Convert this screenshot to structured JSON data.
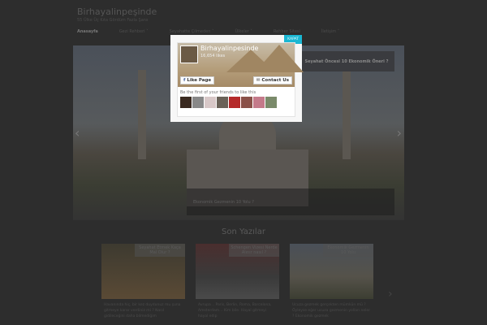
{
  "header": {
    "title": "Birhayalinpeşinde",
    "tagline": "55 Ülke Üç Kıta Gördüm Fazla Şans"
  },
  "nav": [
    {
      "label": "Anasayfa"
    },
    {
      "label": "Gezi Rehberi ˅"
    },
    {
      "label": "Seyahatte Çilmeden ˅"
    },
    {
      "label": "Ülkeler ˅"
    },
    {
      "label": "Rehber Sitesi"
    },
    {
      "label": "İletişim ˅"
    }
  ],
  "slider": {
    "side_title": "Seyahat Öncesi 10 Ekonomik Öneri ?",
    "caption": "Ekonomik Gezmenin 10 Yolu ?",
    "prev": "‹",
    "next": "›"
  },
  "section": {
    "title": "Son Yazılar",
    "next": "›"
  },
  "posts": [
    {
      "title": "Seyahat Etmek Kaça Mal Olur ?",
      "excerpt": "Havanında hiç, bir kez duydunuz mu şuna gitmeye karar verdiniz mi ? Nasıl gidileceğini daha bilmediğim"
    },
    {
      "title": "Schengen Vizesi Nerde Alınır nasıl ?",
      "excerpt": "Avrupa .. Paris, Berlin, Roma, Barcelona, Amsterdam... Kim bile. Hayal gitmeyi hayal edip"
    },
    {
      "title": "Ekonomik Gezmenin 10 Yolu",
      "excerpt": "Ucuza gezmek gerçekten mümkün mü ? Öyleyse eğer ucuza gezmenin yolları neler ? Ekonomik gezmek"
    }
  ],
  "popup": {
    "close": "KAPAT",
    "page_name": "Birhayalinpesinde",
    "likes": "16,654 likes",
    "like_button": "Like Page",
    "contact_button": "Contact Us",
    "friends_text": "Be the first of your friends to like this"
  },
  "colors": {
    "accent": "#1ab7d3",
    "facebook": "#3b5998"
  }
}
